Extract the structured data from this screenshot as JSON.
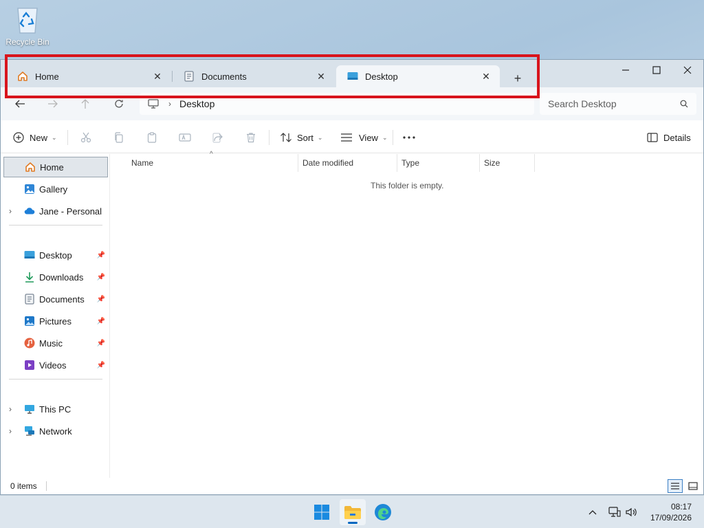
{
  "desktop": {
    "recycle_bin_label": "Recycle Bin"
  },
  "window": {
    "tabs": [
      {
        "label": "Home",
        "icon": "home-icon",
        "active": false
      },
      {
        "label": "Documents",
        "icon": "documents-icon",
        "active": false
      },
      {
        "label": "Desktop",
        "icon": "desktop-folder-icon",
        "active": true
      }
    ],
    "new_tab_label": "+"
  },
  "address": {
    "breadcrumb": "Desktop",
    "search_placeholder": "Search Desktop"
  },
  "command_bar": {
    "new_label": "New",
    "sort_label": "Sort",
    "view_label": "View",
    "details_label": "Details"
  },
  "sidebar": {
    "top_items": [
      {
        "label": "Home",
        "selected": true
      },
      {
        "label": "Gallery"
      },
      {
        "label": "Jane - Personal",
        "expandable": true
      }
    ],
    "quick_access": [
      {
        "label": "Desktop"
      },
      {
        "label": "Downloads"
      },
      {
        "label": "Documents"
      },
      {
        "label": "Pictures"
      },
      {
        "label": "Music"
      },
      {
        "label": "Videos"
      }
    ],
    "bottom_items": [
      {
        "label": "This PC"
      },
      {
        "label": "Network"
      }
    ]
  },
  "content": {
    "columns": [
      "Name",
      "Date modified",
      "Type",
      "Size"
    ],
    "empty_message": "This folder is empty."
  },
  "status_bar": {
    "items_text": "0 items"
  },
  "taskbar": {
    "time": "08:17",
    "date": "17/09/2026"
  },
  "colors": {
    "highlight": "#d8141c",
    "accent": "#0067c0"
  }
}
